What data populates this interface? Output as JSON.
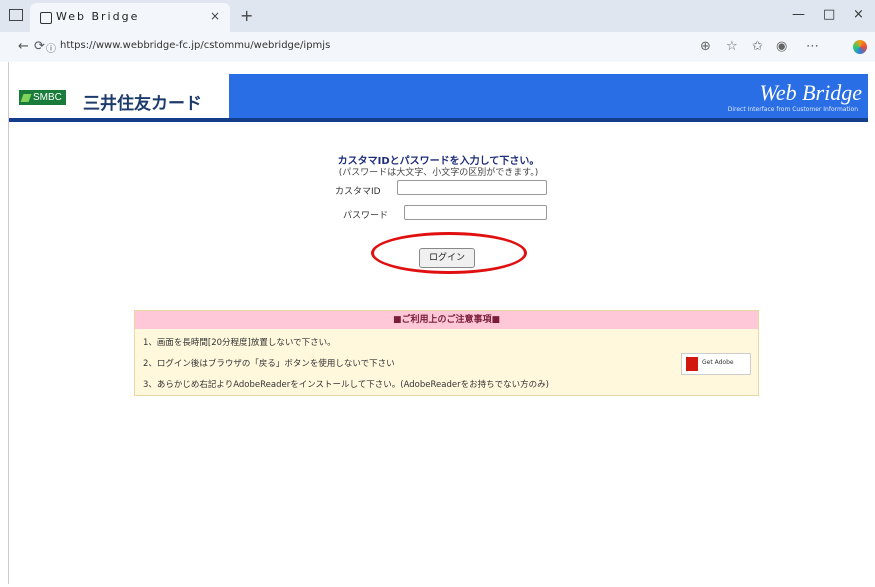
{
  "browser": {
    "tab_title": "Web Bridge",
    "tab_close": "×",
    "new_tab": "+",
    "url": "https://www.webbridge-fc.jp/cstommu/webridge/ipmjs",
    "win_min": "—",
    "win_max": "□",
    "win_close": "×",
    "nav_back": "←",
    "nav_reload": "⟳",
    "url_info_icon": "ⓘ"
  },
  "header": {
    "smbc": "SMBC",
    "brand": "三井住友カード",
    "app_title": "Web Bridge",
    "app_subtitle": "Direct Interface from Customer Information"
  },
  "login": {
    "heading": "カスタマIDとパスワードを入力して下さい。",
    "note": "(パスワードは大文字、小文字の区別ができます。)",
    "customer_id_label": "カスタマID",
    "password_label": "パスワード",
    "login_button": "ログイン"
  },
  "notice": {
    "title": "■ご利用上のご注意事項■",
    "items": [
      "1、画面を長時間[20分程度]放置しないで下さい。",
      "2、ログイン後はブラウザの「戻る」ボタンを使用しないで下さい",
      "3、あらかじめ右記よりAdobeReaderをインストールして下さい。(AdobeReaderをお持ちでない方のみ)"
    ],
    "adobe_label": "Get Adobe"
  },
  "colors": {
    "banner": "#2a6ee6",
    "highlight": "#e01010"
  }
}
